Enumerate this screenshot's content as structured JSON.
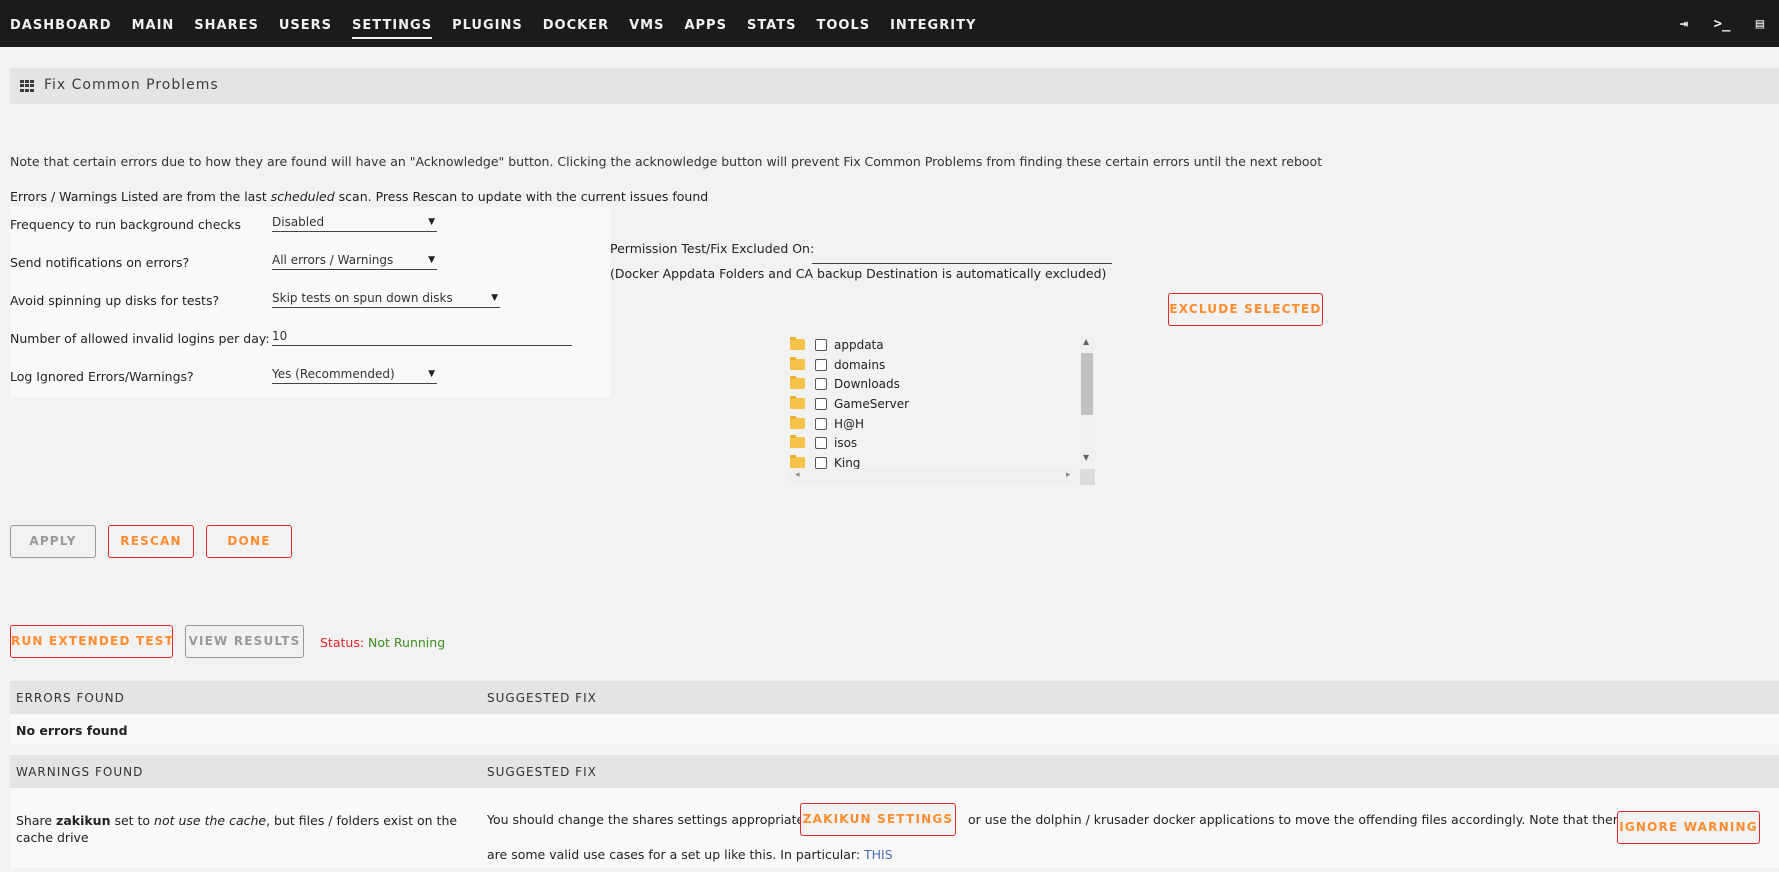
{
  "nav": {
    "items": [
      {
        "label": "DASHBOARD",
        "active": false
      },
      {
        "label": "MAIN",
        "active": false
      },
      {
        "label": "SHARES",
        "active": false
      },
      {
        "label": "USERS",
        "active": false
      },
      {
        "label": "SETTINGS",
        "active": true
      },
      {
        "label": "PLUGINS",
        "active": false
      },
      {
        "label": "DOCKER",
        "active": false
      },
      {
        "label": "VMS",
        "active": false
      },
      {
        "label": "APPS",
        "active": false
      },
      {
        "label": "STATS",
        "active": false
      },
      {
        "label": "TOOLS",
        "active": false
      },
      {
        "label": "INTEGRITY",
        "active": false
      }
    ],
    "icons": [
      "logout-icon",
      "terminal-icon",
      "feedback-icon"
    ]
  },
  "page": {
    "title": "Fix Common Problems",
    "note": "Note that certain errors due to how they are found will have an \"Acknowledge\" button. Clicking the acknowledge button will prevent Fix Common Problems from finding these certain errors until the next reboot",
    "errwarn_prefix": "Errors / Warnings Listed are from the last ",
    "errwarn_emph": "scheduled",
    "errwarn_suffix": " scan. Press Rescan to update with the current issues found"
  },
  "form": {
    "frequency": {
      "label": "Frequency to run background checks",
      "value": "Disabled"
    },
    "notifications": {
      "label": "Send notifications on errors?",
      "value": "All errors / Warnings"
    },
    "spinning": {
      "label": "Avoid spinning up disks for tests?",
      "value": "Skip tests on spun down disks"
    },
    "logins": {
      "label": "Number of allowed invalid logins per day:",
      "value": "10"
    },
    "log_ignored": {
      "label": "Log Ignored Errors/Warnings?",
      "value": "Yes (Recommended)"
    }
  },
  "permission": {
    "label": "Permission Test/Fix Excluded On:",
    "note": "(Docker Appdata Folders and CA backup Destination is automatically excluded)",
    "exclude_button": "EXCLUDE SELECTED",
    "folders": [
      "appdata",
      "domains",
      "Downloads",
      "GameServer",
      "H@H",
      "isos",
      "King"
    ]
  },
  "buttons": {
    "apply": "APPLY",
    "rescan": "RESCAN",
    "done": "DONE",
    "extended": "RUN EXTENDED TEST",
    "view_results": "VIEW RESULTS"
  },
  "status": {
    "label": "Status:",
    "value": "Not Running"
  },
  "errors_table": {
    "col1": "ERRORS FOUND",
    "col2": "SUGGESTED FIX",
    "empty": "No errors found"
  },
  "warnings_table": {
    "col1": "WARNINGS FOUND",
    "col2": "SUGGESTED FIX",
    "row": {
      "w_pre": "Share ",
      "w_share": "zakikun",
      "w_mid": " set to ",
      "w_emph": "not use the cache",
      "w_post": ", but files / folders exist on the cache drive",
      "fix_pre": "You should change the shares settings appropriately",
      "settings_button": "ZAKIKUN SETTINGS",
      "fix_mid": "or use the dolphin / krusader docker applications to move the offending files accordingly. Note that there",
      "fix_line2": "are some valid use cases for a set up like this. In particular: ",
      "fix_link": "THIS",
      "ignore_button": "IGNORE WARNING"
    }
  },
  "colors": {
    "accent_orange": "#ff8c2f",
    "border_red": "#e22828",
    "status_green": "#3b8e1f",
    "link_blue": "#486dba"
  }
}
